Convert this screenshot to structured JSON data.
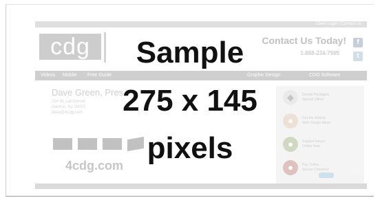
{
  "overlay": {
    "line1": "Sample",
    "line2": "275 x 145",
    "line3": "pixels"
  },
  "site": {
    "top_links": "Client Login | Contact Us",
    "logo_text": "cdg",
    "contact": "Contact Us Today!",
    "phone": "1-888-234-7985",
    "nav": [
      "Videos",
      "Mobile",
      "Free Guide",
      "Graphic Design",
      "CDG Software"
    ],
    "name": "Dave Green, Pres.",
    "address": [
      "254 W. Larchmont",
      "Marlton, NJ 08053",
      "dave@4cdg.com"
    ],
    "watermark": "4cdg.com",
    "side_items": [
      "Design Packages|Special Offers",
      "Get the Hottest|Web Design Ideas",
      "Support Issues|Online Help",
      "Pay Online|Secure Checkout"
    ]
  },
  "colors": {
    "frame_border": "#9a9a9a",
    "overlay_text": "#111111",
    "logo_bg": "#8a8a8a"
  }
}
